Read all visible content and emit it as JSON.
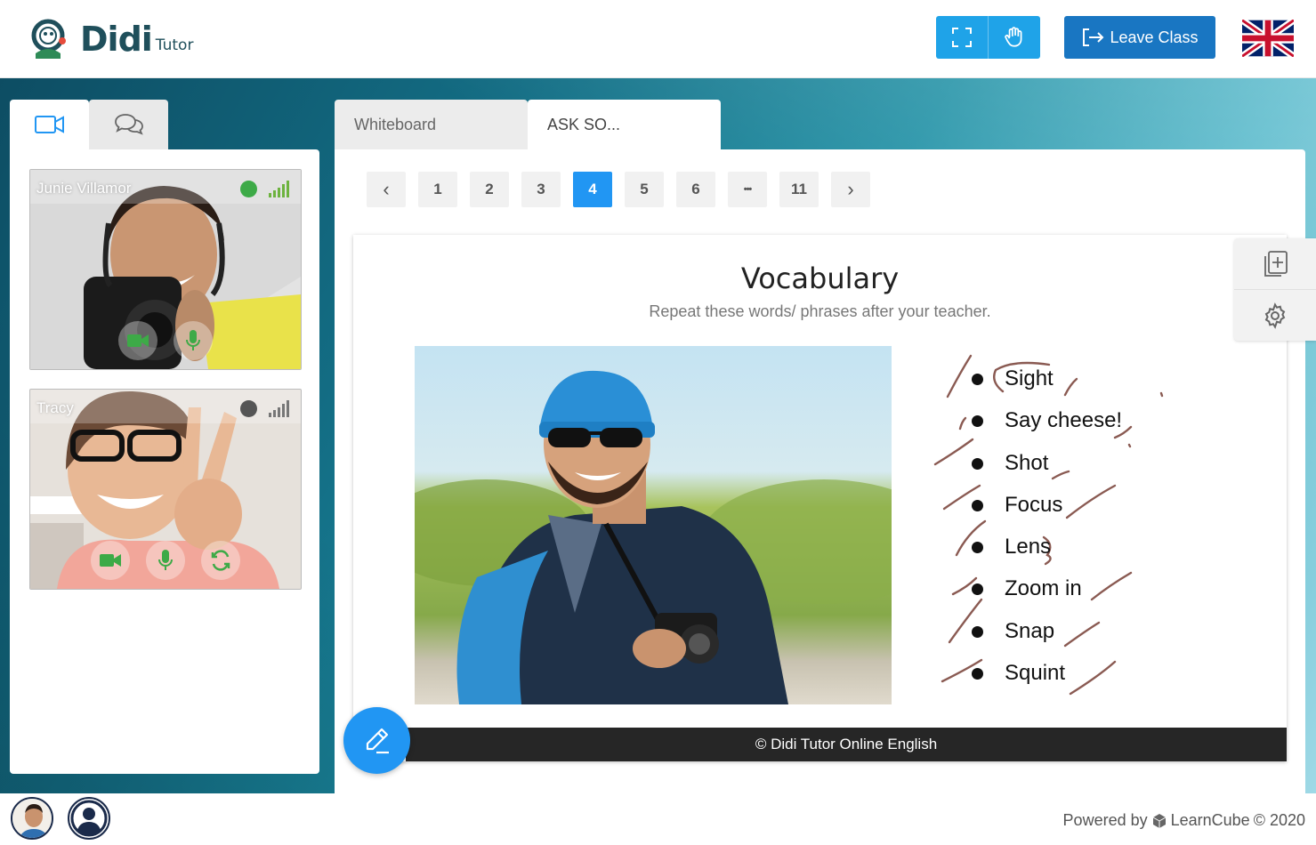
{
  "header": {
    "logo_word": "Didi",
    "logo_sub": "Tutor",
    "leave_label": "Leave Class",
    "flag": "uk-flag"
  },
  "left_tabs": [
    "video-camera-icon",
    "chat-icon"
  ],
  "participants": [
    {
      "name": "Junie Villamor",
      "status_color": "#3daa47"
    },
    {
      "name": "Tracy",
      "status_color": "#555555"
    }
  ],
  "main_tabs": [
    {
      "label": "Whiteboard",
      "active": false
    },
    {
      "label": "ASK SO...",
      "active": true
    }
  ],
  "pager": {
    "prev": "‹",
    "pages": [
      "1",
      "2",
      "3",
      "4",
      "5",
      "6",
      "•••",
      "11"
    ],
    "current": "4",
    "next": "›"
  },
  "slide": {
    "title": "Vocabulary",
    "subtitle": "Repeat these words/ phrases after your teacher.",
    "items": [
      "Sight",
      "Say cheese!",
      "Shot",
      "Focus",
      "Lens",
      "Zoom in",
      "Snap",
      "Squint"
    ],
    "footer": "© Didi Tutor Online English"
  },
  "footer": {
    "powered_prefix": "Powered by",
    "brand": "LearnCube",
    "suffix": "© 2020"
  },
  "colors": {
    "accent": "#2196f3",
    "leave": "#1976c2",
    "tools": "#1fa3e8",
    "scribble": "#8a5a52"
  }
}
